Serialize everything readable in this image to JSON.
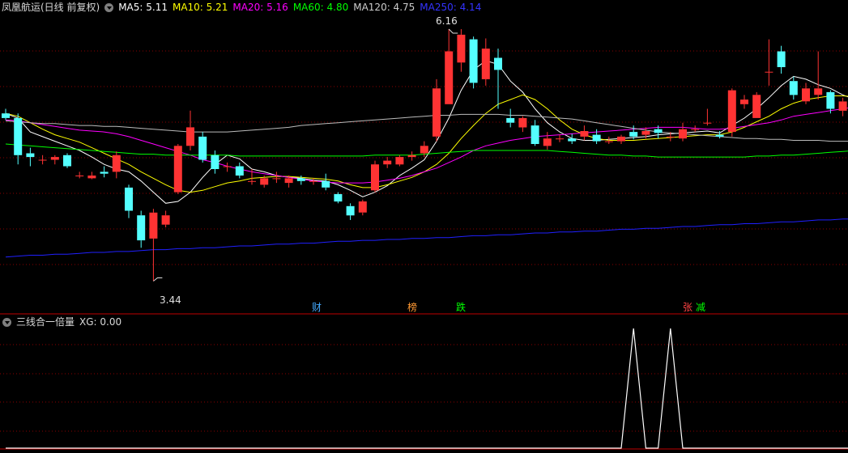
{
  "main_panel": {
    "title": "凤凰航运(日线 前复权)",
    "ma_labels": [
      {
        "text": "MA5: 5.11",
        "color": "#ffffff"
      },
      {
        "text": "MA10: 5.21",
        "color": "#ffff00"
      },
      {
        "text": "MA20: 5.16",
        "color": "#ff00ff"
      },
      {
        "text": "MA60: 4.80",
        "color": "#00ff00"
      },
      {
        "text": "MA120: 4.75",
        "color": "#cccccc"
      },
      {
        "text": "MA250: 4.14",
        "color": "#0000ff"
      }
    ],
    "high_label": "6.16",
    "low_label": "3.44",
    "event_markers": [
      {
        "text": "财",
        "color": "#44aaff"
      },
      {
        "text": "榜",
        "color": "#ff9933"
      },
      {
        "text": "跌",
        "color": "#00ff00"
      },
      {
        "text": "张",
        "color": "#ff4444"
      },
      {
        "text": "减",
        "color": "#00ff00"
      }
    ]
  },
  "sub_panel": {
    "title": "三线合一倍量",
    "xg_label": "XG: 0.00"
  },
  "colors": {
    "up": "#ff3333",
    "down": "#54ffff",
    "grid": "#8b0000",
    "sub_line": "#ffffff"
  },
  "chart_data": [
    {
      "type": "candlestick",
      "ylim": [
        3.2,
        6.3
      ],
      "candles": [
        [
          5.25,
          5.2,
          5.3,
          5.18
        ],
        [
          5.2,
          4.8,
          5.25,
          4.7
        ],
        [
          4.82,
          4.78,
          4.88,
          4.68
        ],
        [
          4.75,
          4.75,
          4.8,
          4.7
        ],
        [
          4.75,
          4.78,
          4.8,
          4.7
        ],
        [
          4.8,
          4.68,
          4.82,
          4.66
        ],
        [
          4.58,
          4.58,
          4.62,
          4.55
        ],
        [
          4.55,
          4.58,
          4.62,
          4.54
        ],
        [
          4.62,
          4.6,
          4.68,
          4.56
        ],
        [
          4.62,
          4.8,
          4.84,
          4.55
        ],
        [
          4.45,
          4.2,
          4.48,
          4.12
        ],
        [
          4.15,
          3.88,
          4.2,
          3.8
        ],
        [
          3.9,
          4.18,
          4.22,
          3.44
        ],
        [
          4.05,
          4.15,
          4.2,
          4.02
        ],
        [
          4.4,
          4.9,
          4.92,
          4.38
        ],
        [
          4.9,
          5.1,
          5.28,
          4.85
        ],
        [
          5.0,
          4.75,
          5.05,
          4.72
        ],
        [
          4.8,
          4.65,
          4.85,
          4.6
        ],
        [
          4.68,
          4.68,
          4.72,
          4.62
        ],
        [
          4.68,
          4.58,
          4.72,
          4.55
        ],
        [
          4.52,
          4.52,
          4.65,
          4.48
        ],
        [
          4.48,
          4.55,
          4.58,
          4.45
        ],
        [
          4.55,
          4.55,
          4.62,
          4.5
        ],
        [
          4.5,
          4.55,
          4.58,
          4.45
        ],
        [
          4.55,
          4.52,
          4.58,
          4.48
        ],
        [
          4.52,
          4.52,
          4.55,
          4.48
        ],
        [
          4.52,
          4.45,
          4.6,
          4.42
        ],
        [
          4.38,
          4.3,
          4.4,
          4.28
        ],
        [
          4.25,
          4.15,
          4.28,
          4.1
        ],
        [
          4.18,
          4.3,
          4.32,
          4.15
        ],
        [
          4.42,
          4.7,
          4.74,
          4.4
        ],
        [
          4.7,
          4.74,
          4.78,
          4.66
        ],
        [
          4.7,
          4.78,
          4.8,
          4.68
        ],
        [
          4.78,
          4.8,
          4.84,
          4.74
        ],
        [
          4.82,
          4.9,
          4.95,
          4.78
        ],
        [
          5.0,
          5.52,
          5.62,
          4.95
        ],
        [
          5.35,
          5.92,
          6.16,
          5.35
        ],
        [
          5.8,
          6.1,
          6.16,
          5.7
        ],
        [
          6.05,
          5.58,
          6.08,
          5.52
        ],
        [
          5.62,
          5.95,
          6.06,
          5.55
        ],
        [
          5.85,
          5.72,
          5.95,
          5.3
        ],
        [
          5.2,
          5.15,
          5.3,
          5.1
        ],
        [
          5.1,
          5.2,
          5.22,
          5.05
        ],
        [
          5.12,
          4.92,
          5.18,
          4.9
        ],
        [
          4.9,
          4.98,
          5.05,
          4.86
        ],
        [
          4.98,
          4.98,
          5.02,
          4.94
        ],
        [
          4.98,
          4.95,
          5.03,
          4.92
        ],
        [
          5.0,
          5.06,
          5.12,
          4.96
        ],
        [
          5.02,
          4.95,
          5.08,
          4.92
        ],
        [
          4.95,
          4.95,
          5.0,
          4.92
        ],
        [
          4.95,
          5.0,
          5.02,
          4.92
        ],
        [
          5.05,
          5.0,
          5.12,
          4.97
        ],
        [
          5.02,
          5.06,
          5.1,
          4.98
        ],
        [
          5.08,
          5.04,
          5.12,
          4.98
        ],
        [
          5.0,
          5.0,
          5.05,
          4.95
        ],
        [
          4.98,
          5.08,
          5.15,
          4.95
        ],
        [
          5.08,
          5.08,
          5.12,
          5.05
        ],
        [
          5.15,
          5.15,
          5.3,
          5.12
        ],
        [
          5.02,
          5.0,
          5.06,
          4.98
        ],
        [
          5.05,
          5.5,
          5.52,
          5.0
        ],
        [
          5.35,
          5.4,
          5.45,
          5.3
        ],
        [
          5.2,
          5.45,
          5.48,
          5.2
        ],
        [
          5.7,
          5.7,
          6.05,
          5.55
        ],
        [
          5.92,
          5.75,
          5.98,
          5.68
        ],
        [
          5.6,
          5.45,
          5.65,
          5.4
        ],
        [
          5.38,
          5.52,
          5.58,
          5.35
        ],
        [
          5.45,
          5.52,
          5.92,
          5.4
        ],
        [
          5.48,
          5.3,
          5.5,
          5.25
        ],
        [
          5.28,
          5.38,
          5.42,
          5.22
        ],
        [
          5.35,
          5.4,
          5.42,
          5.3
        ],
        [
          5.36,
          5.38,
          5.45,
          5.33
        ],
        [
          5.35,
          5.42,
          5.44,
          5.33
        ],
        [
          5.4,
          5.35,
          5.45,
          5.32
        ],
        [
          5.35,
          5.32,
          5.4,
          5.3
        ]
      ],
      "ma_series": [
        {
          "name": "MA5",
          "values": [
            5.25,
            5.2,
            5.05,
            5.0,
            4.95,
            4.9,
            4.85,
            4.78,
            4.7,
            4.65,
            4.62,
            4.52,
            4.4,
            4.28,
            4.3,
            4.4,
            4.56,
            4.7,
            4.8,
            4.76,
            4.65,
            4.62,
            4.58,
            4.56,
            4.55,
            4.53,
            4.52,
            4.48,
            4.42,
            4.35,
            4.4,
            4.47,
            4.58,
            4.66,
            4.75,
            4.95,
            5.2,
            5.5,
            5.72,
            5.82,
            5.78,
            5.6,
            5.48,
            5.3,
            5.15,
            5.05,
            4.98,
            4.96,
            4.96,
            4.97,
            4.98,
            4.99,
            5.0,
            5.02,
            5.03,
            5.04,
            5.05,
            5.06,
            5.04,
            5.12,
            5.2,
            5.3,
            5.42,
            5.55,
            5.65,
            5.62,
            5.56,
            5.52,
            5.45,
            5.4,
            5.38,
            5.37,
            5.37,
            5.36
          ]
        },
        {
          "name": "MA10",
          "values": [
            5.25,
            5.22,
            5.15,
            5.08,
            5.02,
            4.98,
            4.94,
            4.88,
            4.82,
            4.76,
            4.7,
            4.62,
            4.55,
            4.48,
            4.42,
            4.4,
            4.42,
            4.46,
            4.5,
            4.52,
            4.55,
            4.56,
            4.57,
            4.57,
            4.56,
            4.55,
            4.54,
            4.52,
            4.48,
            4.45,
            4.45,
            4.48,
            4.52,
            4.56,
            4.62,
            4.7,
            4.82,
            4.98,
            5.12,
            5.25,
            5.35,
            5.4,
            5.45,
            5.4,
            5.3,
            5.18,
            5.08,
            5.02,
            4.98,
            4.96,
            4.96,
            4.96,
            4.97,
            4.98,
            4.99,
            5.0,
            5.01,
            5.02,
            5.02,
            5.05,
            5.1,
            5.16,
            5.22,
            5.3,
            5.36,
            5.4,
            5.42,
            5.44,
            5.44,
            5.43,
            5.41,
            5.4,
            5.38,
            5.37
          ]
        },
        {
          "name": "MA20",
          "values": [
            5.18,
            5.17,
            5.15,
            5.13,
            5.11,
            5.09,
            5.07,
            5.06,
            5.05,
            5.03,
            5.0,
            4.96,
            4.92,
            4.88,
            4.84,
            4.8,
            4.75,
            4.72,
            4.68,
            4.65,
            4.62,
            4.6,
            4.58,
            4.56,
            4.54,
            4.52,
            4.51,
            4.5,
            4.5,
            4.5,
            4.51,
            4.53,
            4.55,
            4.58,
            4.62,
            4.66,
            4.72,
            4.78,
            4.85,
            4.9,
            4.93,
            4.96,
            4.98,
            5.0,
            5.01,
            5.02,
            5.03,
            5.04,
            5.05,
            5.06,
            5.07,
            5.08,
            5.09,
            5.1,
            5.1,
            5.1,
            5.09,
            5.08,
            5.08,
            5.09,
            5.11,
            5.13,
            5.15,
            5.18,
            5.22,
            5.24,
            5.26,
            5.28,
            5.3,
            5.32,
            5.33,
            5.33,
            5.33,
            5.32
          ]
        },
        {
          "name": "MA60",
          "values": [
            4.92,
            4.91,
            4.9,
            4.89,
            4.88,
            4.87,
            4.86,
            4.85,
            4.84,
            4.83,
            4.82,
            4.81,
            4.81,
            4.8,
            4.8,
            4.8,
            4.8,
            4.8,
            4.8,
            4.79,
            4.79,
            4.79,
            4.79,
            4.79,
            4.79,
            4.79,
            4.79,
            4.79,
            4.79,
            4.79,
            4.8,
            4.8,
            4.8,
            4.8,
            4.81,
            4.82,
            4.83,
            4.84,
            4.85,
            4.85,
            4.85,
            4.85,
            4.85,
            4.85,
            4.85,
            4.84,
            4.83,
            4.82,
            4.81,
            4.8,
            4.8,
            4.79,
            4.79,
            4.78,
            4.78,
            4.78,
            4.78,
            4.78,
            4.78,
            4.78,
            4.78,
            4.79,
            4.79,
            4.8,
            4.8,
            4.81,
            4.82,
            4.83,
            4.84,
            4.85,
            4.86,
            4.87,
            4.88,
            4.9
          ]
        },
        {
          "name": "MA120",
          "values": [
            5.17,
            5.16,
            5.15,
            5.14,
            5.14,
            5.13,
            5.12,
            5.12,
            5.11,
            5.11,
            5.1,
            5.09,
            5.08,
            5.07,
            5.06,
            5.05,
            5.05,
            5.05,
            5.05,
            5.06,
            5.07,
            5.08,
            5.09,
            5.1,
            5.12,
            5.13,
            5.14,
            5.15,
            5.16,
            5.17,
            5.18,
            5.19,
            5.2,
            5.21,
            5.22,
            5.23,
            5.23,
            5.24,
            5.24,
            5.24,
            5.24,
            5.23,
            5.23,
            5.22,
            5.21,
            5.2,
            5.19,
            5.17,
            5.15,
            5.13,
            5.11,
            5.09,
            5.07,
            5.05,
            5.04,
            5.03,
            5.02,
            5.01,
            5.0,
            4.99,
            4.98,
            4.98,
            4.97,
            4.97,
            4.96,
            4.96,
            4.96,
            4.95,
            4.95,
            4.95,
            4.95,
            4.95,
            4.95,
            4.95
          ]
        },
        {
          "name": "MA250",
          "values": [
            3.7,
            3.71,
            3.72,
            3.72,
            3.73,
            3.73,
            3.74,
            3.75,
            3.75,
            3.76,
            3.76,
            3.77,
            3.78,
            3.78,
            3.79,
            3.79,
            3.8,
            3.8,
            3.81,
            3.82,
            3.82,
            3.83,
            3.84,
            3.84,
            3.85,
            3.85,
            3.86,
            3.87,
            3.87,
            3.88,
            3.88,
            3.89,
            3.89,
            3.9,
            3.9,
            3.91,
            3.91,
            3.92,
            3.93,
            3.93,
            3.94,
            3.94,
            3.95,
            3.96,
            3.96,
            3.97,
            3.97,
            3.98,
            3.98,
            3.99,
            4.0,
            4.0,
            4.01,
            4.01,
            4.02,
            4.03,
            4.03,
            4.04,
            4.05,
            4.05,
            4.06,
            4.06,
            4.07,
            4.08,
            4.08,
            4.09,
            4.1,
            4.1,
            4.11,
            4.11,
            4.12,
            4.13,
            4.13,
            4.14
          ]
        }
      ]
    },
    {
      "type": "line",
      "name": "XG",
      "ylim": [
        0,
        1
      ],
      "values": [
        0,
        0,
        0,
        0,
        0,
        0,
        0,
        0,
        0,
        0,
        0,
        0,
        0,
        0,
        0,
        0,
        0,
        0,
        0,
        0,
        0,
        0,
        0,
        0,
        0,
        0,
        0,
        0,
        0,
        0,
        0,
        0,
        0,
        0,
        0,
        0,
        0,
        0,
        0,
        0,
        0,
        0,
        0,
        0,
        0,
        0,
        0,
        0,
        0,
        0,
        0,
        1,
        0,
        0,
        1,
        0,
        0,
        0,
        0,
        0,
        0,
        0,
        0,
        0,
        0,
        0,
        0,
        0,
        0,
        0,
        0,
        0,
        0,
        0
      ]
    }
  ]
}
